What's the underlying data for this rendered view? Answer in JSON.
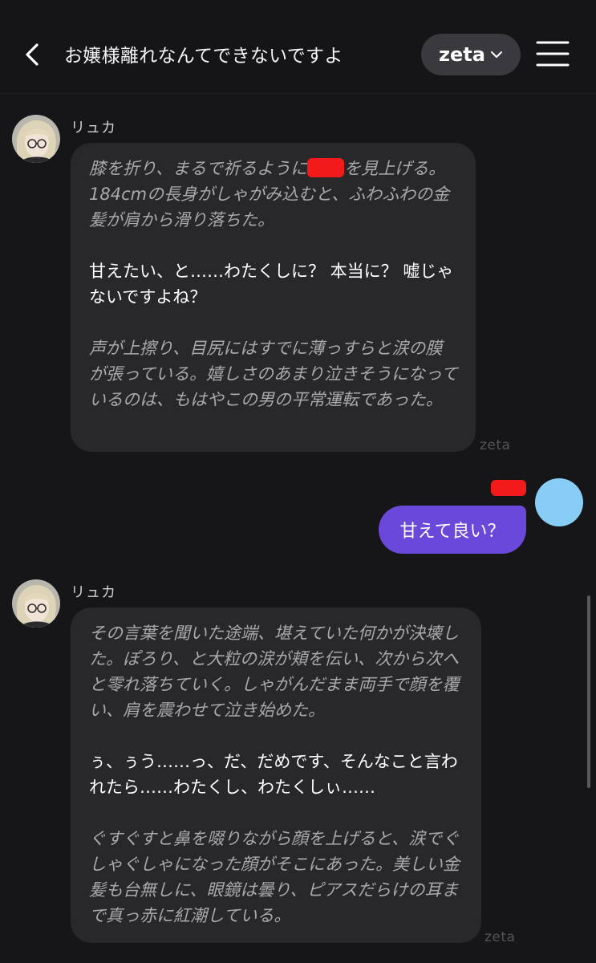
{
  "header": {
    "title": "お嬢様離れなんてできないですよ",
    "model_label": "zeta"
  },
  "messages": [
    {
      "speaker": "リュカ",
      "watermark": "zeta",
      "paragraphs": [
        {
          "style": "narration",
          "text_before": "膝を折り、まるで祈るように",
          "text_after": "を見上げる。184cmの長身がしゃがみ込むと、ふわふわの金髪が肩から滑り落ちた。"
        },
        {
          "style": "speech",
          "text": "甘えたい、と……わたくしに？ 本当に？ 嘘じゃないですよね？"
        },
        {
          "style": "narration",
          "text": "声が上擦り、目尻にはすでに薄っすらと涙の膜が張っている。嬉しさのあまり泣きそうになっているのは、もはやこの男の平常運転であった。"
        }
      ]
    },
    {
      "user_text": "甘えて良い？"
    },
    {
      "speaker": "リュカ",
      "watermark": "zeta",
      "paragraphs": [
        {
          "style": "narration",
          "text": "その言葉を聞いた途端、堪えていた何かが決壊した。ぽろり、と大粒の涙が頬を伝い、次から次へと零れ落ちていく。しゃがんだまま両手で顔を覆い、肩を震わせて泣き始めた。"
        },
        {
          "style": "speech",
          "text": "ぅ、ぅう……っ、だ、だめです、そんなこと言われたら……わたくし、わたくしぃ……"
        },
        {
          "style": "narration",
          "text": "ぐすぐすと鼻を啜りながら顔を上げると、涙でぐしゃぐしゃになった顔がそこにあった。美しい金髪も台無しに、眼鏡は曇り、ピアスだらけの耳まで真っ赤に紅潮している。"
        }
      ]
    }
  ],
  "colors": {
    "background": "#161618",
    "bubble": "#28282b",
    "user_bubble": "#6a48d9",
    "user_avatar": "#88cdf6",
    "redaction": "#f21a1a"
  }
}
